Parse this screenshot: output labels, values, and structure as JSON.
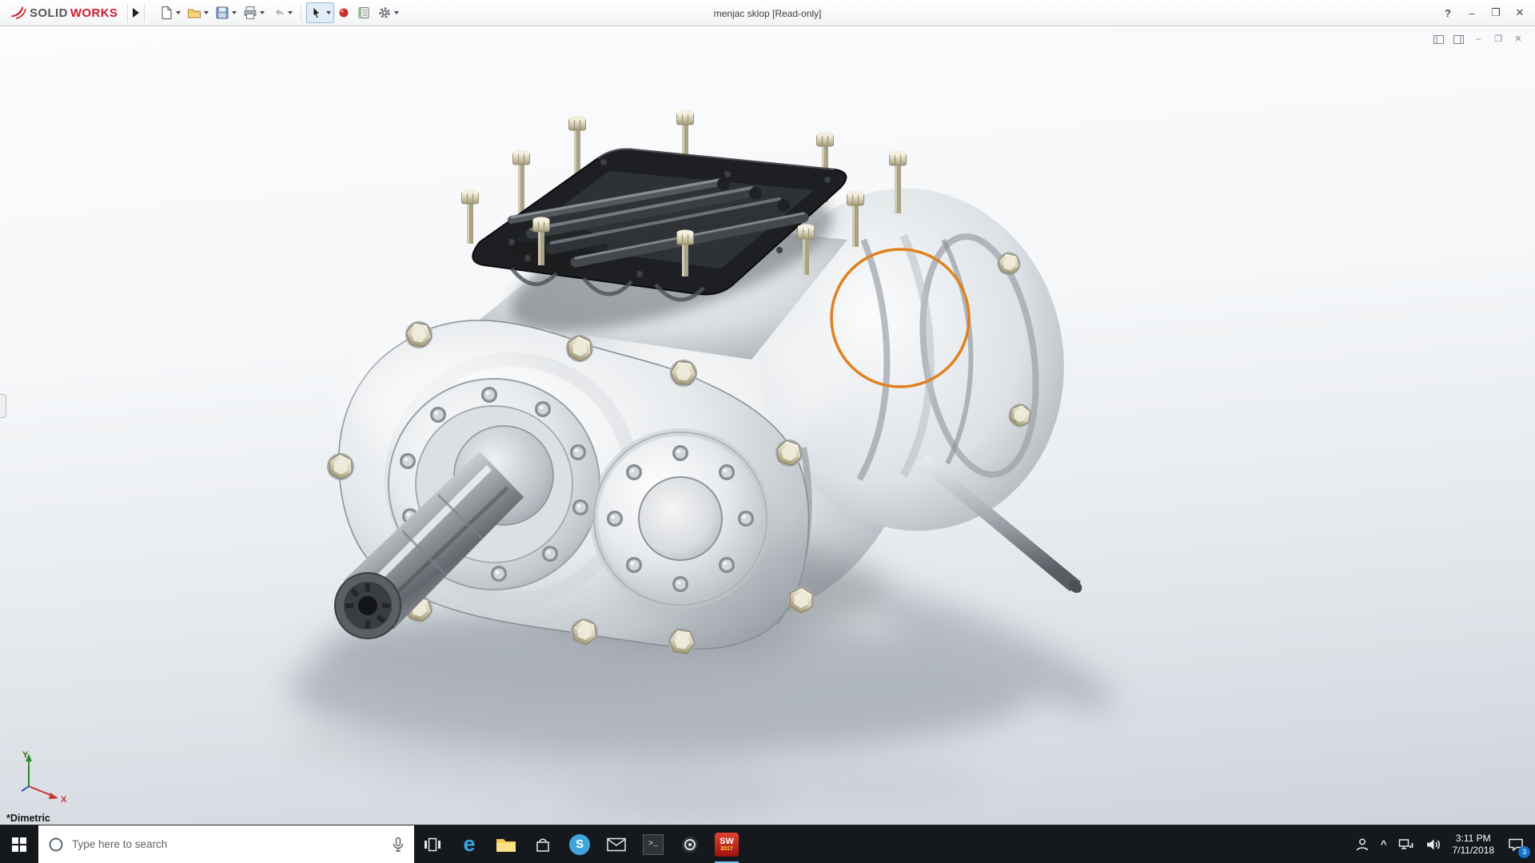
{
  "app": {
    "logo": {
      "solid": "SOLID",
      "works": "WORKS"
    },
    "doc_title": "menjac sklop [Read-only]",
    "window": {
      "help": "?",
      "minimize": "–",
      "restore": "❐",
      "close": "✕"
    },
    "doc_window": {
      "minimize": "–",
      "restore": "❐",
      "close": "✕"
    }
  },
  "toolbar": {
    "tools": [
      "new-document",
      "open",
      "save",
      "print",
      "undo",
      "select",
      "appearance",
      "design-library",
      "options"
    ]
  },
  "viewport": {
    "view_label": "*Dimetric",
    "triad": {
      "x": "X",
      "y": "Y"
    },
    "annotation": {
      "shape": "circle",
      "color": "#e0801f"
    }
  },
  "taskbar": {
    "search_placeholder": "Type here to search",
    "edge_glyph": "e",
    "skype_glyph": "S",
    "terminal_glyph": ">_",
    "solidworks_label": "SW",
    "solidworks_year": "2017",
    "tray": {
      "expand_glyph": "^",
      "time": "3:11 PM",
      "date": "7/11/2018",
      "notification_count": "3"
    }
  }
}
